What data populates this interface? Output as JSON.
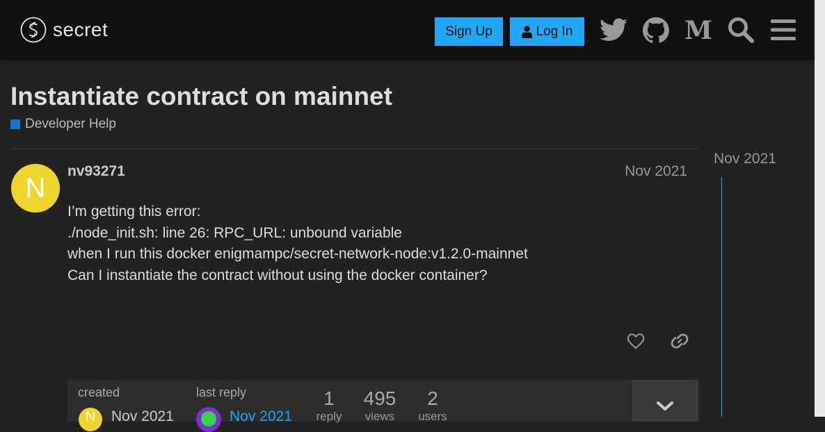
{
  "header": {
    "logo_text": "secret",
    "signup_label": "Sign Up",
    "login_label": "Log In",
    "icons": [
      "twitter-icon",
      "github-icon",
      "medium-icon",
      "search-icon",
      "hamburger-menu-icon"
    ]
  },
  "topic": {
    "title": "Instantiate contract on mainnet",
    "category": "Developer Help",
    "category_color": "#1277c9"
  },
  "post": {
    "avatar_letter": "N",
    "avatar_color": "#efd42b",
    "username": "nv93271",
    "date": "Nov 2021",
    "lines": [
      "I’m getting this error:",
      "./node_init.sh: line 26: RPC_URL: unbound variable",
      "when I run this docker enigmampc/secret-network-node:v1.2.0-mainnet",
      "Can I instantiate the contract without using the docker container?"
    ]
  },
  "topic_map": {
    "created_label": "created",
    "created_date": "Nov 2021",
    "created_avatar_letter": "N",
    "last_reply_label": "last reply",
    "last_reply_date": "Nov 2021",
    "stats": [
      {
        "value": "1",
        "label": "reply"
      },
      {
        "value": "495",
        "label": "views"
      },
      {
        "value": "2",
        "label": "users"
      }
    ]
  },
  "timeline": {
    "date": "Nov 2021"
  },
  "colors": {
    "accent": "#1fa8f5",
    "background": "#222222",
    "header": "#111111"
  }
}
